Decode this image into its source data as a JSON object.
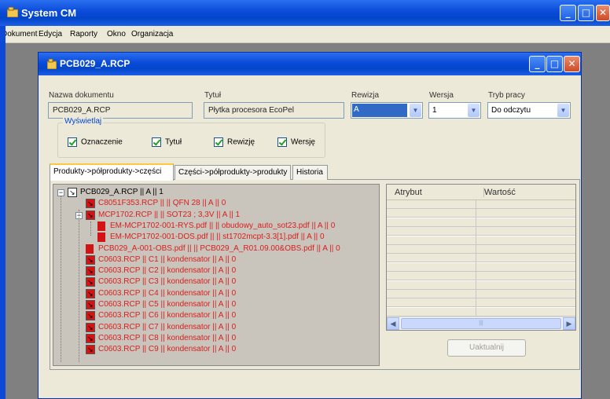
{
  "app": {
    "title": "System CM"
  },
  "menu": [
    "Dokument",
    "Edycja",
    "Raporty",
    "Okno",
    "Organizacja"
  ],
  "child": {
    "title": "PCB029_A.RCP",
    "fields": {
      "nazwa_label": "Nazwa dokumentu",
      "nazwa_value": "PCB029_A.RCP",
      "tytul_label": "Tytuł",
      "tytul_value": "Płytka procesora EcoPel",
      "rewizja_label": "Rewizja",
      "rewizja_value": "A",
      "wersja_label": "Wersja",
      "wersja_value": "1",
      "tryb_label": "Tryb pracy",
      "tryb_value": "Do odczytu"
    },
    "display_group": {
      "title": "Wyświetlaj",
      "options": [
        {
          "label": "Oznaczenie",
          "checked": true
        },
        {
          "label": "Tytuł",
          "checked": true
        },
        {
          "label": "Rewizję",
          "checked": true
        },
        {
          "label": "Wersję",
          "checked": true
        }
      ]
    },
    "tabs": [
      "Produkty->półprodukty->części",
      "Części->półprodukty->produkty",
      "Historia"
    ],
    "tree": [
      {
        "text": "PCB029_A.RCP || A || 1",
        "level": 0,
        "red": false,
        "icon": "document-link-icon",
        "expander": "−"
      },
      {
        "text": "C8051F353.RCP || || QFN 28 || A || 0",
        "level": 1,
        "red": true,
        "icon": "component-link-icon"
      },
      {
        "text": "MCP1702.RCP || || SOT23 ; 3,3V || A || 1",
        "level": 1,
        "red": true,
        "icon": "component-link-icon",
        "expander": "−"
      },
      {
        "text": "EM-MCP1702-001-RYS.pdf || || obudowy_auto_sot23.pdf || A || 0",
        "level": 2,
        "red": true,
        "icon": "pdf-file-icon"
      },
      {
        "text": "EM-MCP1702-001-DOS.pdf || || st1702mcpt-3.3[1].pdf || A || 0",
        "level": 2,
        "red": true,
        "icon": "pdf-file-icon"
      },
      {
        "text": "PCB029_A-001-OBS.pdf || || PCB029_A_R01.09.00&OBS.pdf || A || 0",
        "level": 1,
        "red": true,
        "icon": "pdf-file-icon"
      },
      {
        "text": "C0603.RCP || C1 || kondensator || A || 0",
        "level": 1,
        "red": true,
        "icon": "component-link-icon"
      },
      {
        "text": "C0603.RCP || C2 || kondensator || A || 0",
        "level": 1,
        "red": true,
        "icon": "component-link-icon"
      },
      {
        "text": "C0603.RCP || C3 || kondensator || A || 0",
        "level": 1,
        "red": true,
        "icon": "component-link-icon"
      },
      {
        "text": "C0603.RCP || C4 || kondensator || A || 0",
        "level": 1,
        "red": true,
        "icon": "component-link-icon"
      },
      {
        "text": "C0603.RCP || C5 || kondensator || A || 0",
        "level": 1,
        "red": true,
        "icon": "component-link-icon"
      },
      {
        "text": "C0603.RCP || C6 || kondensator || A || 0",
        "level": 1,
        "red": true,
        "icon": "component-link-icon"
      },
      {
        "text": "C0603.RCP || C7 || kondensator || A || 0",
        "level": 1,
        "red": true,
        "icon": "component-link-icon"
      },
      {
        "text": "C0603.RCP || C8 || kondensator || A || 0",
        "level": 1,
        "red": true,
        "icon": "component-link-icon"
      },
      {
        "text": "C0603.RCP || C9 || kondensator || A || 0",
        "level": 1,
        "red": true,
        "icon": "component-link-icon"
      }
    ],
    "grid": {
      "col1": "Atrybut",
      "col2": "Wartość"
    },
    "update_button": "Uaktualnij"
  }
}
